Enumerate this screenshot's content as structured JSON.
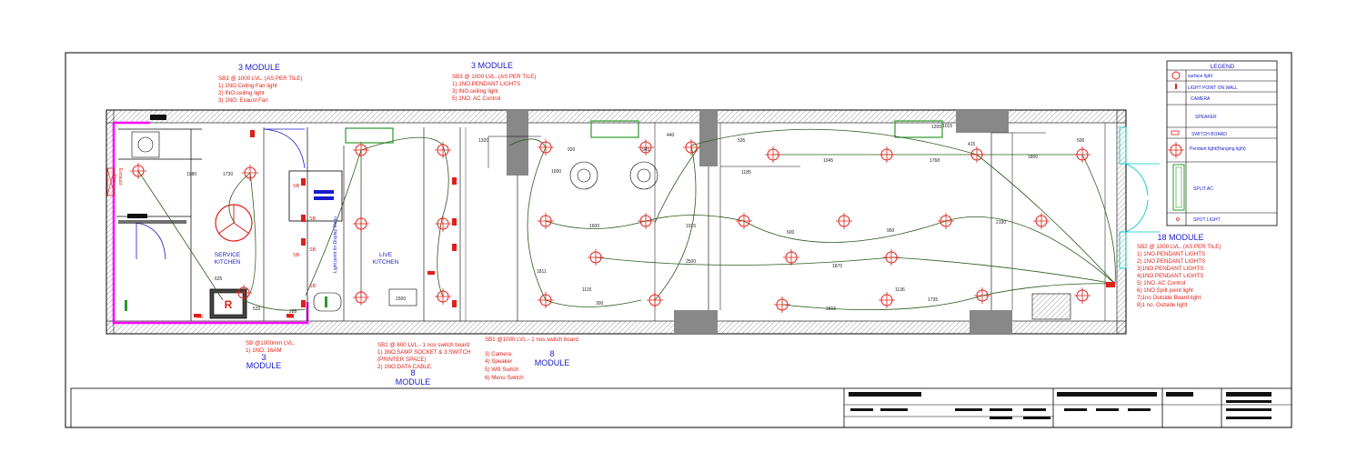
{
  "modules": {
    "top_left": {
      "title": "3 MODULE",
      "lines": [
        "SB3 @ 1000 LVL. (AS PER TILE)",
        "1) 1NO.Celing Fan light",
        "2) INO.ceiling light",
        "3) 1NO. Exaust Fan"
      ]
    },
    "top_center": {
      "title": "3 MODULE",
      "lines": [
        "SB3 @ 1000 LVL. (AS PER TILE)",
        "1) 1NO.PENDANT LIGHTS",
        "3) INO.ceiling light",
        "5) 1NO. AC Control"
      ]
    },
    "right": {
      "title": "18 MODULE",
      "lines": [
        "SB2 @ 1000 LVL. (AS PER TILE)",
        "1) 1NO.PENDANT LIGHTS",
        "2) 1NO.PENDANT LIGHTS",
        "3)1NO.PENDANT LIGHTS",
        "4)1NO.PENDANT LIGHTS",
        "5) 1NO. AC Control",
        "6) 1NO.Spilt point light",
        "7)1no Outside Board light",
        "8)1 no. Outside light"
      ]
    },
    "bottom_sb": {
      "lines": [
        "SB @1000mm LVL.",
        "1) 1NO. 16AM"
      ],
      "module_num": "3",
      "module_word": "MODULE"
    },
    "bottom_sb1a": {
      "lines": [
        "SB1 @ 600 LVL.- 1 nos switch board",
        "1) 3NO.5AMP SOCKET & 3 SWITCH",
        "(PRINTER SPACE)",
        "2) 1NO.DATA CABLE."
      ],
      "module_num": "8",
      "module_word": "MODULE"
    },
    "bottom_sb1b": {
      "title": "SB1 @1000 LVL.- 1 nos switch board",
      "lines": [
        "3)     Camera",
        "4)     Speaker",
        "5)     Wifi Switch",
        "6)     Menu Switch"
      ],
      "module_num": "8",
      "module_word": "MODULE"
    }
  },
  "legend": {
    "title": "LEGEND",
    "items": [
      {
        "label": "surface light",
        "icon": "surface-light-icon"
      },
      {
        "label": "LIGHT POINT ON WALL",
        "icon": "wall-light-icon"
      },
      {
        "label": "CAMERA",
        "icon": "camera-icon"
      },
      {
        "label": "SPEAKER",
        "icon": "speaker-icon"
      },
      {
        "label": "SWITCH BOARD",
        "icon": "switch-board-icon"
      },
      {
        "label": "Pendant light(Hanging light)",
        "icon": "pendant-light-icon"
      },
      {
        "label": "SPLIT AC",
        "icon": "split-ac-icon"
      },
      {
        "label": "SPOT LIGHT",
        "icon": "spot-light-icon"
      }
    ]
  },
  "rooms": {
    "service_kitchen": [
      "SERVICE",
      "KITCHEN"
    ],
    "live_kitchen": [
      "LIVE",
      "KITCHEN"
    ],
    "menu_light": "Light point for Display Menu",
    "exhaust": [
      "Exhaust",
      "Fan"
    ],
    "fridge_mark": "R",
    "sb": "SB"
  },
  "dims": [
    "1980",
    "1730",
    "1320",
    "1200",
    "1500",
    "1045",
    "1768",
    "1800",
    "1600",
    "1915",
    "2190",
    "2500",
    "1870",
    "1811",
    "1000",
    "1735",
    "1815",
    "300",
    "1015",
    "600",
    "950",
    "920",
    "945",
    "440",
    "535",
    "415",
    "1115",
    "1136",
    "500",
    "1185",
    "625",
    "533",
    "285"
  ],
  "colors": {
    "accent": "#e0201a",
    "wire": "#2a5a1a",
    "module": "#1a1acc",
    "ac": "#00c8c8",
    "wall": "#ff00ff"
  }
}
